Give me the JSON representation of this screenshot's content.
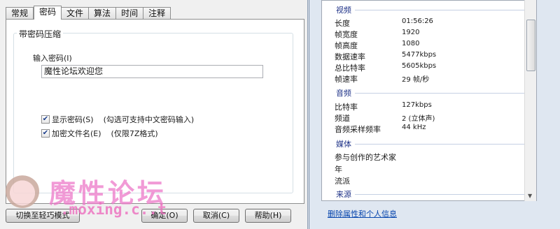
{
  "left": {
    "tabs": [
      "常规",
      "密码",
      "文件",
      "算法",
      "时间",
      "注释"
    ],
    "active_tab": "密码",
    "group_title": "带密码压缩",
    "password_label": "输入密码(I)",
    "password_value": "魔性论坛欢迎您",
    "show_password": {
      "label": "显示密码(S)",
      "hint": "(勾选可支持中文密码输入)",
      "checked": true
    },
    "encrypt_names": {
      "label": "加密文件名(E)",
      "hint": "(仅限7Z格式)",
      "checked": true
    },
    "buttons": {
      "switch": "切换至轻巧模式",
      "ok": "确定(O)",
      "cancel": "取消(C)",
      "help": "帮助(H)"
    },
    "watermark": {
      "text": "魔性论坛",
      "url": ".moxing.c..t"
    }
  },
  "right": {
    "video_header": "视频",
    "video": [
      {
        "k": "长度",
        "v": "01:56:26"
      },
      {
        "k": "帧宽度",
        "v": "1920"
      },
      {
        "k": "帧高度",
        "v": "1080"
      },
      {
        "k": "数据速率",
        "v": "5477kbps"
      },
      {
        "k": "总比特率",
        "v": "5605kbps"
      },
      {
        "k": "帧速率",
        "v": "29 帧/秒"
      }
    ],
    "audio_header": "音频",
    "audio": [
      {
        "k": "比特率",
        "v": "127kbps"
      },
      {
        "k": "频道",
        "v": "2 (立体声)"
      },
      {
        "k": "音频采样频率",
        "v": "44 kHz"
      }
    ],
    "media_header": "媒体",
    "media": [
      {
        "k": "参与创作的艺术家",
        "v": ""
      },
      {
        "k": "年",
        "v": ""
      },
      {
        "k": "流派",
        "v": ""
      }
    ],
    "source_header": "来源",
    "remove_link": "删除属性和个人信息"
  }
}
